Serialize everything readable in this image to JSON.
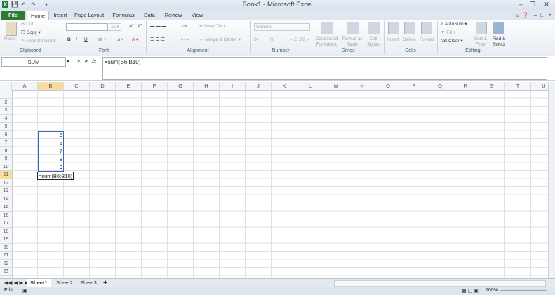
{
  "window": {
    "title": "Book1 - Microsoft Excel"
  },
  "tabs": [
    "File",
    "Home",
    "Insert",
    "Page Layout",
    "Formulas",
    "Data",
    "Review",
    "View"
  ],
  "ribbon": {
    "clipboard": {
      "paste": "Paste",
      "cut": "Cut",
      "copy": "Copy",
      "format_painter": "Format Painter",
      "label": "Clipboard"
    },
    "font": {
      "size": "11",
      "label": "Font",
      "bold": "B",
      "italic": "I",
      "underline": "U",
      "grow": "Aˆ",
      "shrink": "Aˇ"
    },
    "alignment": {
      "wrap": "Wrap Text",
      "merge": "Merge & Center",
      "label": "Alignment"
    },
    "number": {
      "format": "General",
      "percent": "%",
      "comma": ",",
      "label": "Number"
    },
    "styles": {
      "conditional": "Conditional Formatting",
      "format_table": "Format as Table",
      "cell_styles": "Cell Styles",
      "label": "Styles"
    },
    "cells": {
      "insert": "Insert",
      "delete": "Delete",
      "format": "Format",
      "label": "Cells"
    },
    "editing": {
      "autosum": "AutoSum",
      "fill": "Fill",
      "clear": "Clear",
      "sort": "Sort & Filter",
      "find": "Find & Select",
      "label": "Editing"
    }
  },
  "formula_bar": {
    "name_box": "SUM",
    "formula": "=sum(B6:B10)",
    "cancel": "✕",
    "enter": "✔",
    "fx": "fx"
  },
  "columns": [
    "A",
    "B",
    "C",
    "D",
    "E",
    "F",
    "G",
    "H",
    "I",
    "J",
    "K",
    "L",
    "M",
    "N",
    "O",
    "P",
    "Q",
    "R",
    "S",
    "T",
    "U"
  ],
  "rows": [
    "1",
    "2",
    "3",
    "4",
    "5",
    "6",
    "7",
    "8",
    "9",
    "10",
    "11",
    "12",
    "13",
    "14",
    "15",
    "16",
    "17",
    "18",
    "19",
    "20",
    "21",
    "22",
    "23"
  ],
  "cells": {
    "B6": "5",
    "B7": "6",
    "B8": "7",
    "B9": "8",
    "B10": "9",
    "B11": "=sum(B6:B10)"
  },
  "sheets": [
    "Sheet1",
    "Sheet2",
    "Sheet3"
  ],
  "status": {
    "mode": "Edit",
    "zoom": "100%"
  }
}
